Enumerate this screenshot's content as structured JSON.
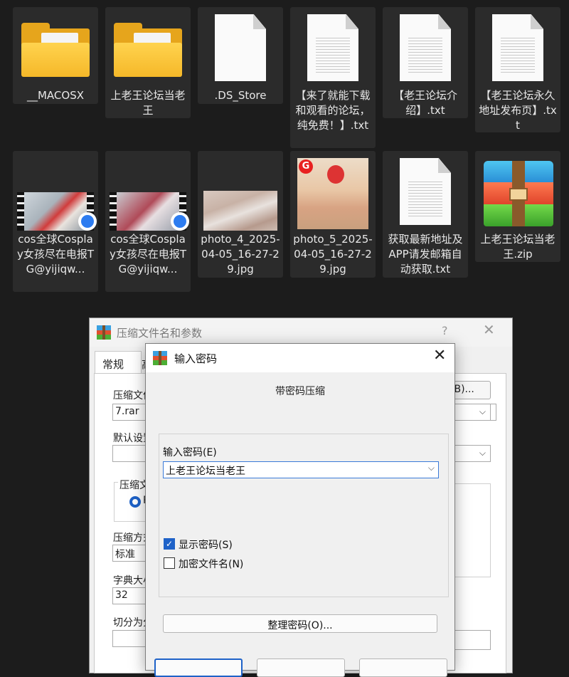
{
  "files": [
    {
      "name": "__MACOSX",
      "type": "folder"
    },
    {
      "name": "上老王论坛当老王",
      "type": "folder"
    },
    {
      "name": ".DS_Store",
      "type": "file"
    },
    {
      "name": "【来了就能下载和观看的论坛，纯免费！】.txt",
      "type": "txt"
    },
    {
      "name": "【老王论坛介绍】.txt",
      "type": "txt"
    },
    {
      "name": "【老王论坛永久地址发布页】.txt",
      "type": "txt"
    },
    {
      "name": "cos全球Cosplay女孩尽在电报TG@yijiqw...",
      "type": "video"
    },
    {
      "name": "cos全球Cosplay女孩尽在电报TG@yijiqw...",
      "type": "video"
    },
    {
      "name": "photo_4_2025-04-05_16-27-29.jpg",
      "type": "image"
    },
    {
      "name": "photo_5_2025-04-05_16-27-29.jpg",
      "type": "image"
    },
    {
      "name": "获取最新地址及APP请发邮箱自动获取.txt",
      "type": "txt"
    },
    {
      "name": "上老王论坛当老王.zip",
      "type": "archive"
    }
  ],
  "archive_dialog": {
    "title": "压缩文件名和参数",
    "help": "?",
    "close": "✕",
    "tab_general": "常规",
    "tab_advanced": "高",
    "filename_label": "压缩文件",
    "filename_value": "7.rar",
    "browse_button": "(B)...",
    "default_settings_label": "默认设置",
    "archive_format_label": "压缩文",
    "archive_format_radio": "R",
    "method_label": "压缩方式",
    "method_value": "标准",
    "dictionary_label": "字典大小",
    "dictionary_value": "32",
    "split_label": "切分为分"
  },
  "password_dialog": {
    "title": "输入密码",
    "close": "✕",
    "subtitle": "带密码压缩",
    "password_label": "输入密码(E)",
    "password_value": "上老王论坛当老王",
    "show_password": {
      "label": "显示密码(S)",
      "checked": true
    },
    "encrypt_filenames": {
      "label": "加密文件名(N)",
      "checked": false
    },
    "organize_button": "整理密码(O)..."
  }
}
